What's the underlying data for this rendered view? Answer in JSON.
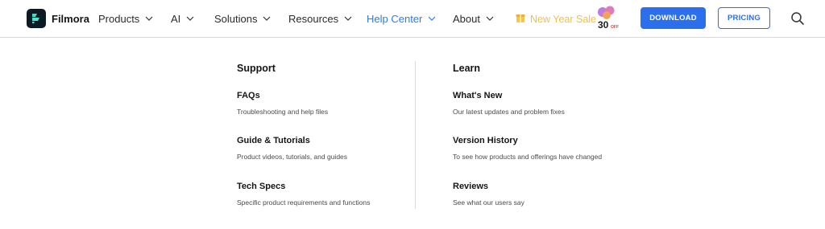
{
  "brand": {
    "name": "Filmora",
    "logo_icon": "filmora-logo-icon"
  },
  "nav": {
    "items": [
      {
        "label": "Products",
        "active": false
      },
      {
        "label": "AI",
        "active": false
      },
      {
        "label": "Solutions",
        "active": false
      },
      {
        "label": "Resources",
        "active": false
      },
      {
        "label": "Help Center",
        "active": true
      },
      {
        "label": "About",
        "active": false
      }
    ],
    "promo": {
      "label": "New Year Sale",
      "badge": "30%OFF",
      "icon": "gift-icon"
    },
    "download_label": "DOWNLOAD",
    "pricing_label": "PRICING",
    "search_icon": "search-icon"
  },
  "colors": {
    "accent": "#2c6fed",
    "active_nav": "#2f7ae5",
    "promo": "#f0c14b",
    "text": "#151515"
  },
  "menu": {
    "support": {
      "title": "Support",
      "items": [
        {
          "title": "FAQs",
          "desc": "Troubleshooting and help files"
        },
        {
          "title": "Guide & Tutorials",
          "desc": "Product videos, tutorials, and guides"
        },
        {
          "title": "Tech Specs",
          "desc": "Specific product requirements and functions"
        }
      ]
    },
    "learn": {
      "title": "Learn",
      "items": [
        {
          "title": "What's New",
          "desc": "Our latest updates and problem fixes"
        },
        {
          "title": "Version History",
          "desc": "To see how products and offerings have changed"
        },
        {
          "title": "Reviews",
          "desc": "See what our users say"
        }
      ]
    }
  }
}
